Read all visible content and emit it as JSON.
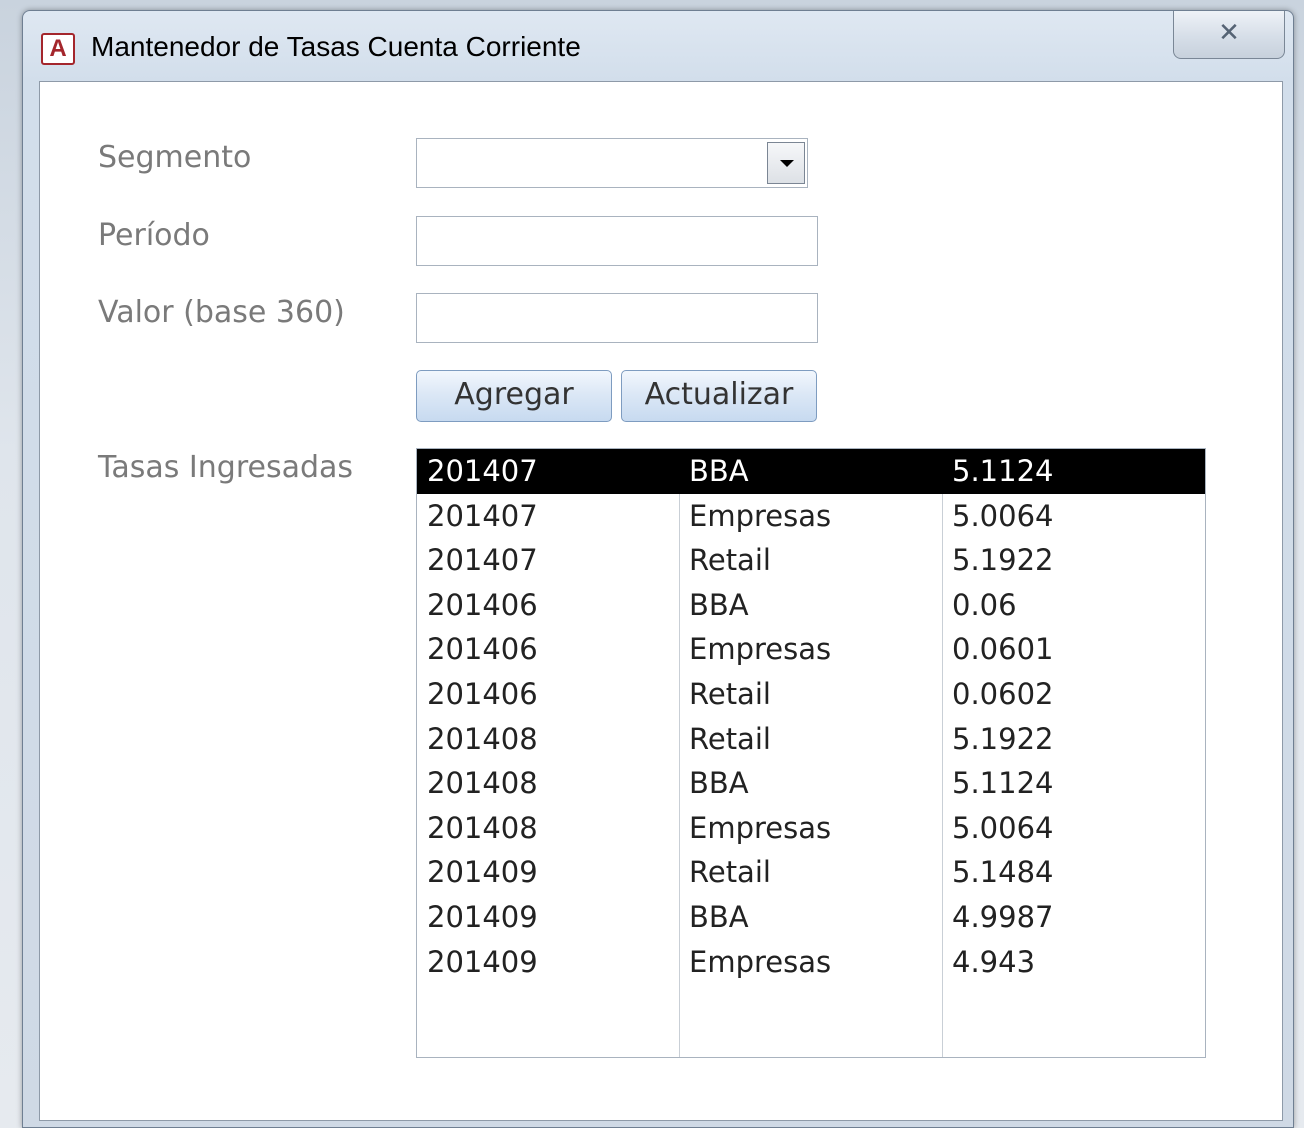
{
  "window": {
    "title": "Mantenedor de Tasas Cuenta Corriente",
    "app_icon_letter": "A",
    "close_glyph": "✕"
  },
  "form": {
    "segmento_label": "Segmento",
    "segmento_value": "",
    "periodo_label": "Período",
    "periodo_value": "",
    "valor_label": "Valor (base 360)",
    "valor_value": "",
    "agregar_label": "Agregar",
    "actualizar_label": "Actualizar",
    "tasas_label": "Tasas Ingresadas"
  },
  "tasas": {
    "selected_index": 0,
    "rows": [
      {
        "periodo": "201407",
        "segmento": "BBA",
        "valor": "5.1124"
      },
      {
        "periodo": "201407",
        "segmento": "Empresas",
        "valor": "5.0064"
      },
      {
        "periodo": "201407",
        "segmento": "Retail",
        "valor": "5.1922"
      },
      {
        "periodo": "201406",
        "segmento": "BBA",
        "valor": "0.06"
      },
      {
        "periodo": "201406",
        "segmento": "Empresas",
        "valor": "0.0601"
      },
      {
        "periodo": "201406",
        "segmento": "Retail",
        "valor": "0.0602"
      },
      {
        "periodo": "201408",
        "segmento": "Retail",
        "valor": "5.1922"
      },
      {
        "periodo": "201408",
        "segmento": "BBA",
        "valor": "5.1124"
      },
      {
        "periodo": "201408",
        "segmento": "Empresas",
        "valor": "5.0064"
      },
      {
        "periodo": "201409",
        "segmento": "Retail",
        "valor": "5.1484"
      },
      {
        "periodo": "201409",
        "segmento": "BBA",
        "valor": "4.9987"
      },
      {
        "periodo": "201409",
        "segmento": "Empresas",
        "valor": "4.943"
      }
    ]
  }
}
